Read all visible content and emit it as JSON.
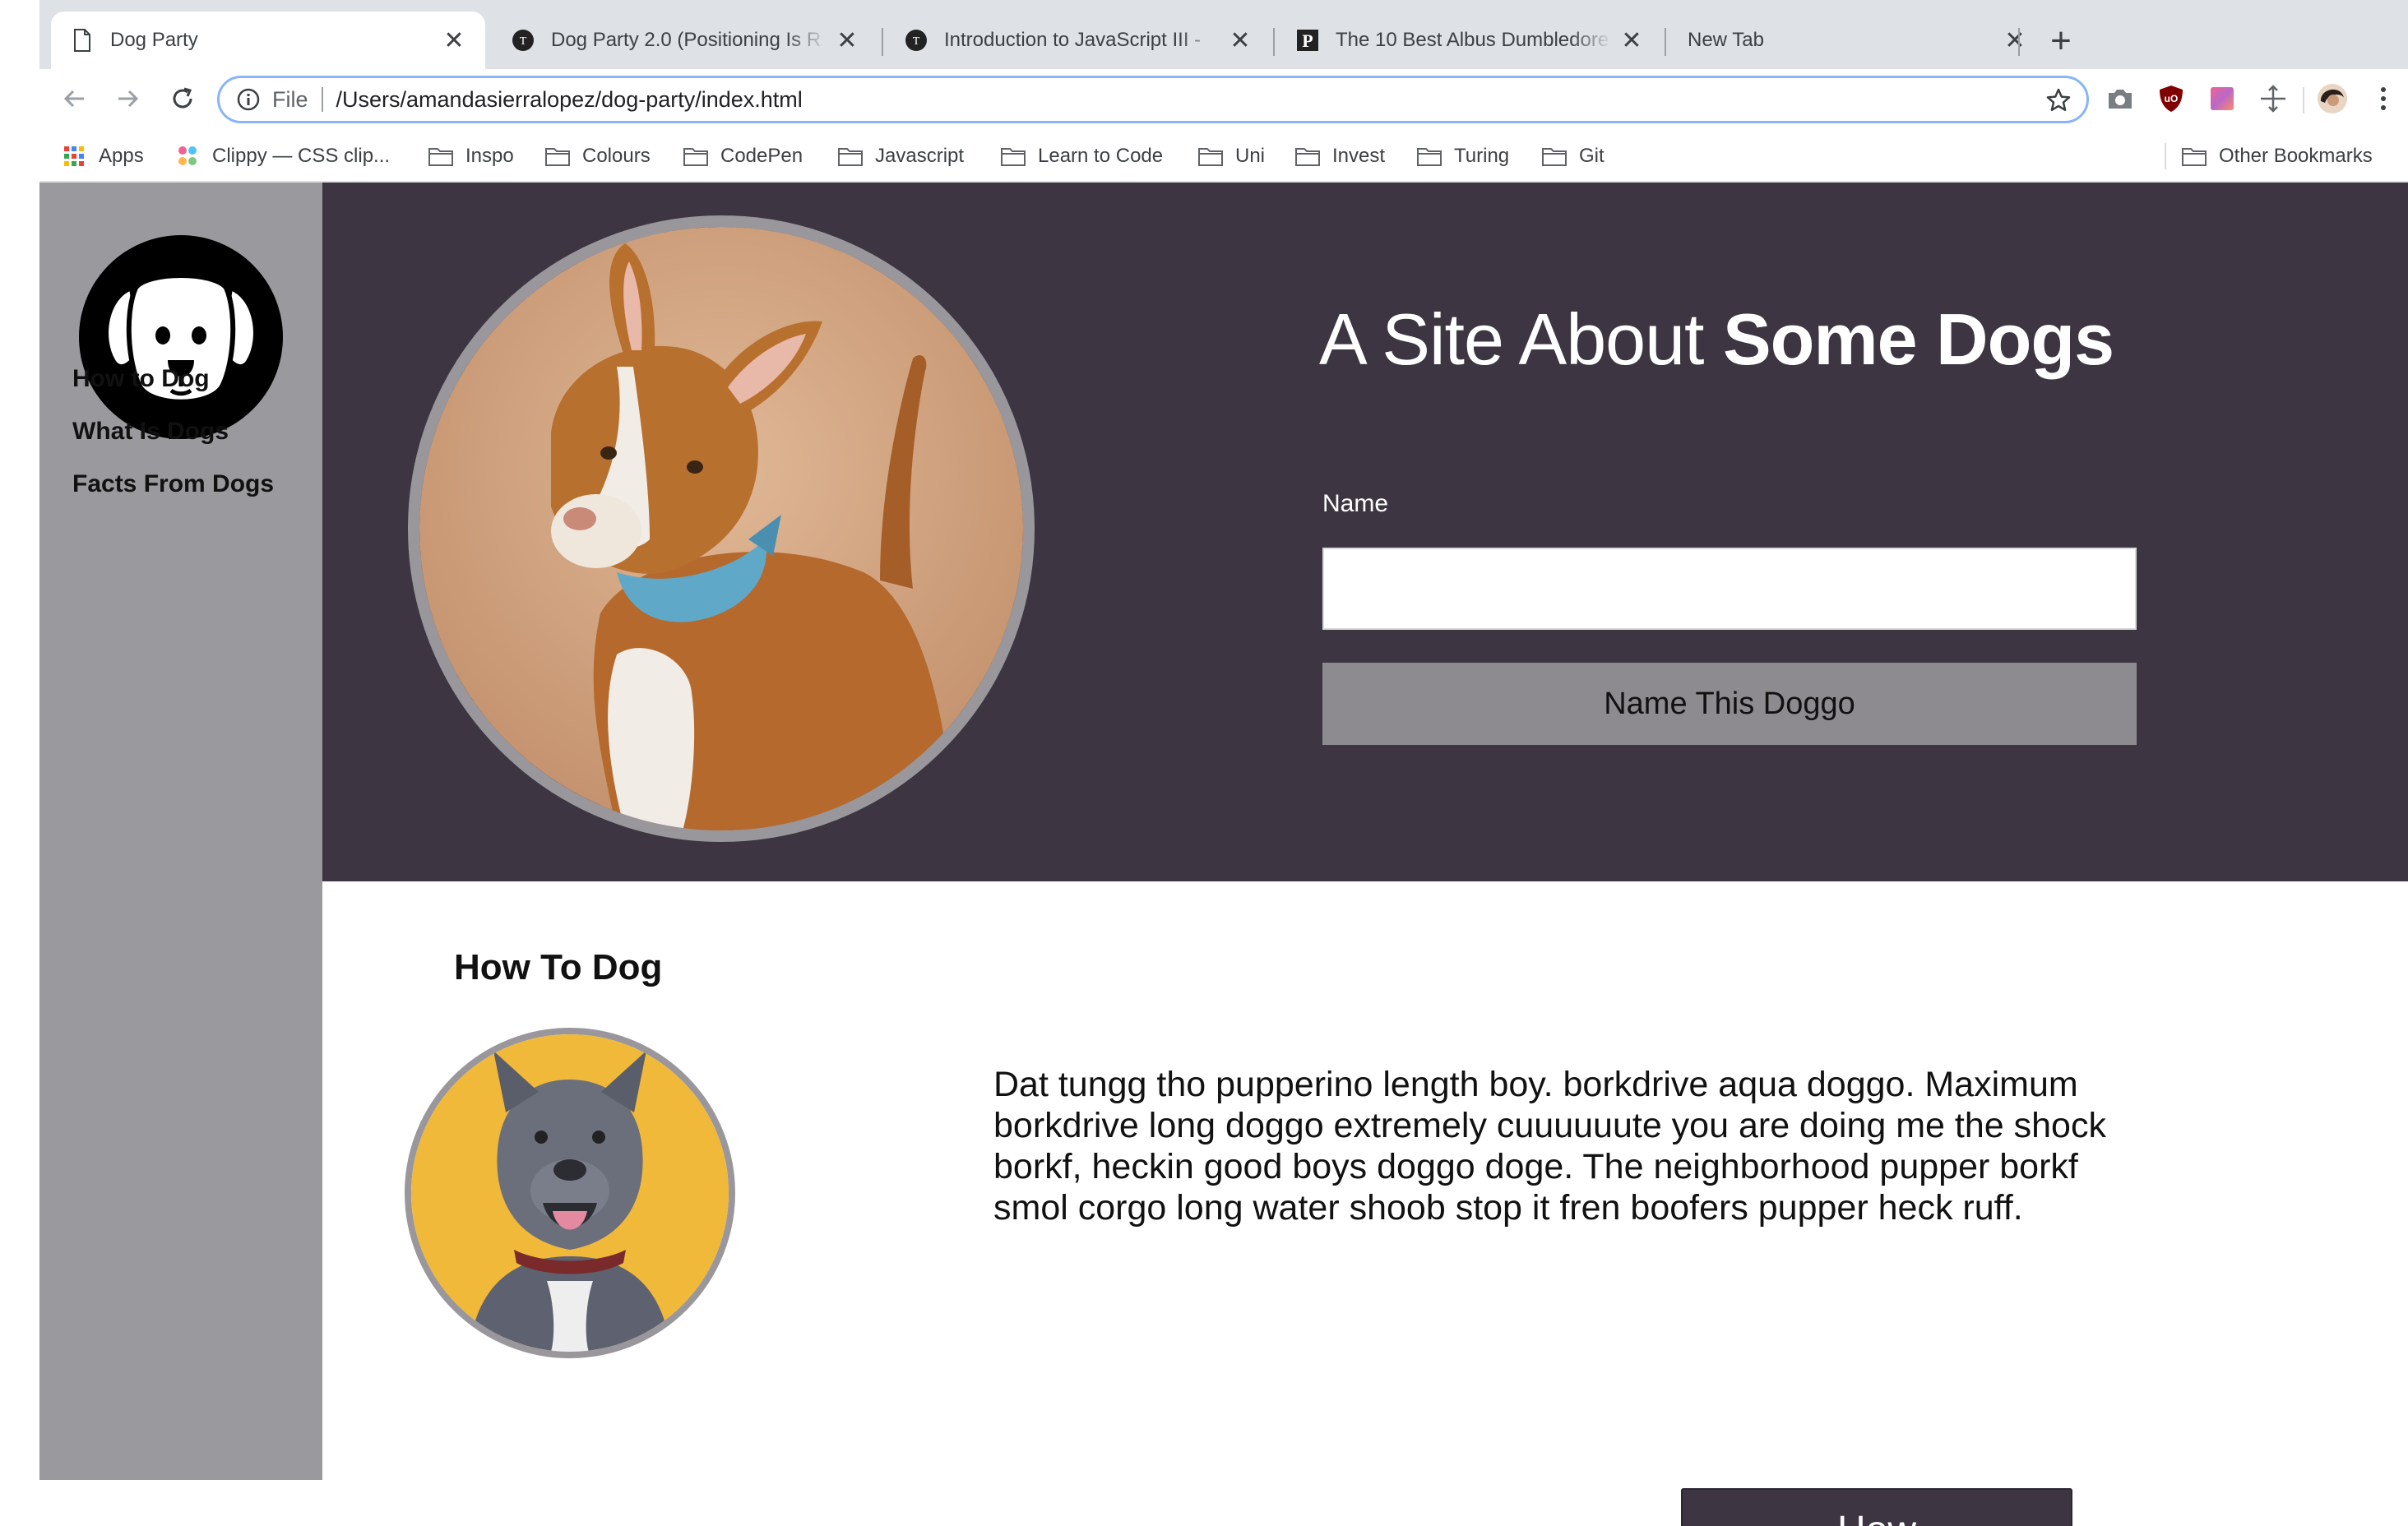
{
  "browser": {
    "tabs": [
      {
        "title": "Dog Party",
        "active": true
      },
      {
        "title": "Dog Party 2.0 (Positioning Is R",
        "active": false
      },
      {
        "title": "Introduction to JavaScript III - ",
        "active": false
      },
      {
        "title": "The 10 Best Albus Dumbledore",
        "active": false
      },
      {
        "title": "New Tab",
        "active": false
      }
    ],
    "new_tab_symbol": "+",
    "close_symbol": "✕",
    "address": {
      "scheme": "File",
      "url": "/Users/amandasierralopez/dog-party/index.html"
    },
    "bookmarks": [
      {
        "label": "Apps",
        "icon": "apps-grid-icon"
      },
      {
        "label": "Clippy — CSS clip...",
        "icon": "clippy-icon"
      },
      {
        "label": "Inspo",
        "icon": "folder-icon"
      },
      {
        "label": "Colours",
        "icon": "folder-icon"
      },
      {
        "label": "CodePen",
        "icon": "folder-icon"
      },
      {
        "label": "Javascript",
        "icon": "folder-icon"
      },
      {
        "label": "Learn to Code",
        "icon": "folder-icon"
      },
      {
        "label": "Uni",
        "icon": "folder-icon"
      },
      {
        "label": "Invest",
        "icon": "folder-icon"
      },
      {
        "label": "Turing",
        "icon": "folder-icon"
      },
      {
        "label": "Git",
        "icon": "folder-icon"
      }
    ],
    "other_bookmarks": "Other Bookmarks"
  },
  "sidebar": {
    "links": [
      "How to Dog",
      "What Is Dogs",
      "Facts From Dogs"
    ]
  },
  "hero": {
    "title_light": "A Site About ",
    "title_bold": "Some Dogs",
    "name_label": "Name",
    "name_value": "",
    "button_label": "Name This Doggo"
  },
  "section": {
    "title": "How To Dog",
    "text": "Dat tungg tho pupperino length boy. borkdrive aqua doggo. Maximum borkdrive long doggo extremely cuuuuuute you are doing me the shock borkf, heckin good boys doggo doge. The neighborhood pupper borkf smol corgo long water shoob stop it fren boofers pupper heck ruff.",
    "button_label": "How"
  },
  "colors": {
    "hero_bg": "#3d3642",
    "sidebar_bg": "#9a999e",
    "button_gray": "#8d8b90",
    "photo_ring": "#99979c"
  }
}
